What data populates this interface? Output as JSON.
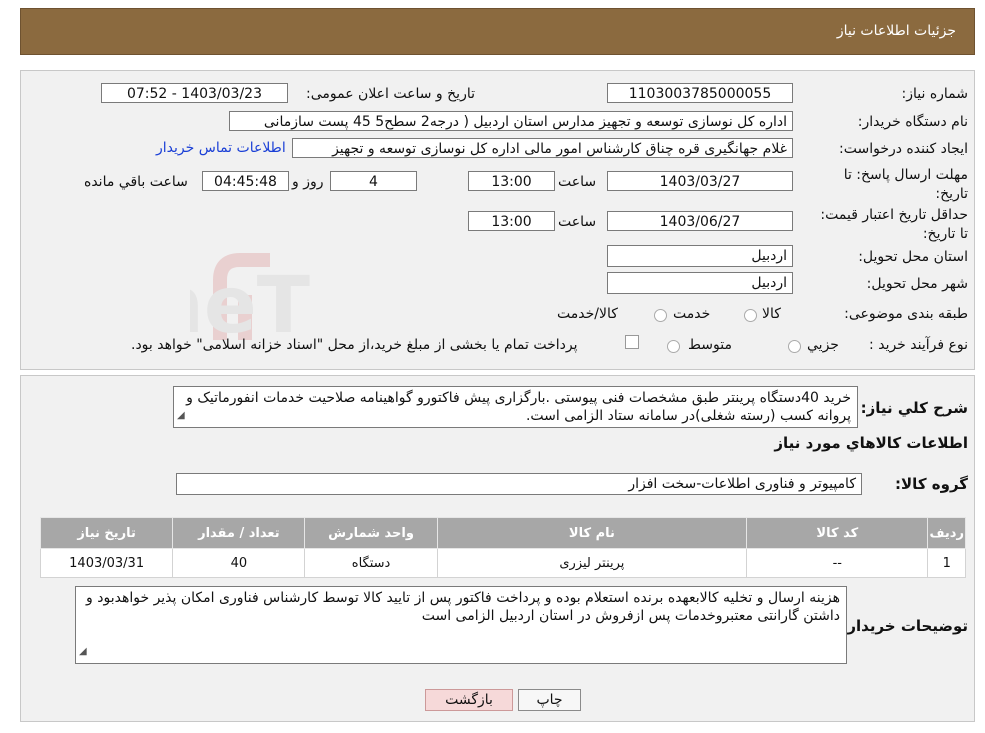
{
  "header": {
    "title": "جزئیات اطلاعات نیاز"
  },
  "form": {
    "need_number_label": "شماره نیاز:",
    "need_number": "1103003785000055",
    "announce_label": "تاریخ و ساعت اعلان عمومی:",
    "announce_value": "1403/03/23 - 07:52",
    "buyer_org_label": "نام دستگاه خریدار:",
    "buyer_org": "اداره کل نوسازی   توسعه و تجهیز مدارس استان اردبیل ( درجه2  سطح5  45 پست سازمانی",
    "requester_label": "ایجاد کننده درخواست:",
    "requester": "غلام جهانگیری قره چناق کارشناس امور مالی اداره کل نوسازی   توسعه و تجهیز",
    "contact_link": "اطلاعات تماس خریدار",
    "deadline_label": "مهلت ارسال پاسخ: تا تاریخ:",
    "deadline_date": "1403/03/27",
    "time_label": "ساعت",
    "deadline_time": "13:00",
    "days_value": "4",
    "days_label": "روز و",
    "remaining_value": "04:45:48",
    "remaining_label": "ساعت باقي مانده",
    "validity_label": "حداقل تاريخ اعتبار قيمت: تا تاريخ:",
    "validity_date": "1403/06/27",
    "validity_time": "13:00",
    "province_label": "استان محل تحویل:",
    "province": "اردبیل",
    "city_label": "شهر محل تحویل:",
    "city": "اردبیل",
    "category_label": "طبقه بندی موضوعی:",
    "category_options": [
      "کالا",
      "خدمت",
      "کالا/خدمت"
    ],
    "process_label": "نوع فرآیند خرید :",
    "process_options": [
      "جزيي",
      "متوسط"
    ],
    "process_note": "پرداخت تمام یا بخشی از مبلغ خرید،از محل \"اسناد خزانه اسلامی\" خواهد بود."
  },
  "watermark": "AriaTender.neT",
  "summary": {
    "label": "شرح کلي نياز:",
    "text": "خرید 40دستگاه پرینتر طبق مشخصات فنی پیوستی .بارگزاری پیش فاکتورو گواهینامه صلاحیت خدمات انفورماتیک و پروانه کسب (رسته شغلی)در سامانه ستاد الزامی است.",
    "items_title": "اطلاعات کالاهاي مورد نياز",
    "group_label": "گروه کالا:",
    "group_value": "کامپیوتر و فناوری اطلاعات-سخت افزار"
  },
  "table": {
    "headers": [
      "رديف",
      "کد کالا",
      "نام کالا",
      "واحد شمارش",
      "تعداد / مقدار",
      "تاريخ نياز"
    ],
    "rows": [
      [
        "1",
        "--",
        "پرینتر لیزری",
        "دستگاه",
        "40",
        "1403/03/31"
      ]
    ]
  },
  "buyer_notes": {
    "label": "توضیحات خریدار:",
    "text": "هزینه ارسال و تخلیه کالابعهده برنده استعلام بوده و پرداخت فاکتور پس از تایید کالا توسط کارشناس فناوری امکان پذیر خواهدبود و داشتن گارانتی معتبروخدمات پس ازفروش در استان اردبیل الزامی است"
  },
  "buttons": {
    "print": "چاپ",
    "back": "بازگشت"
  },
  "colors": {
    "header": "#8b6a3f",
    "link": "#1a3fd6",
    "table_header": "#a7a7a7",
    "back_button": "#f6d9d9"
  }
}
